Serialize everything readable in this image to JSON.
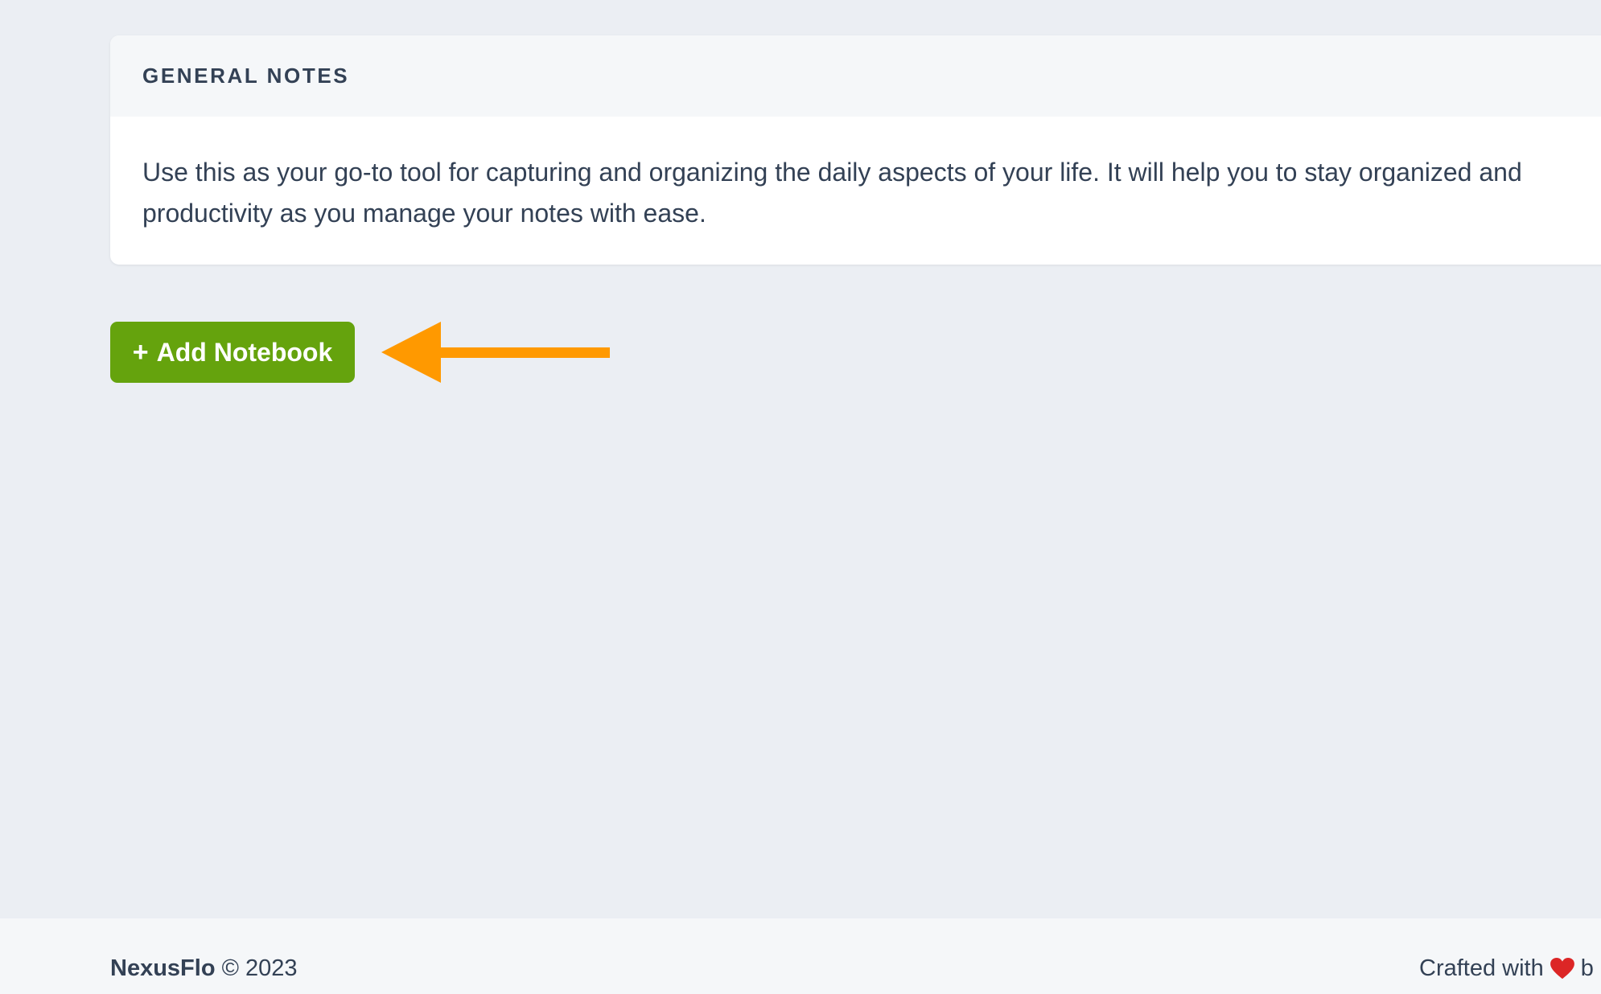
{
  "card": {
    "title": "GENERAL NOTES",
    "description": "Use this as your go-to tool for capturing and organizing the daily aspects of your life. It will help you to stay organized and productivity as you manage your notes with ease."
  },
  "actions": {
    "add_notebook_plus": "+",
    "add_notebook_label": "Add Notebook"
  },
  "footer": {
    "brand": "NexusFlo",
    "copyright": "© 2023",
    "crafted_prefix": "Crafted with",
    "crafted_suffix": "b"
  },
  "colors": {
    "background": "#ebeef3",
    "card_header": "#f5f7f9",
    "primary_button": "#65a30d",
    "annotation_arrow": "#ff9900",
    "heart": "#dc2626",
    "text": "#334155"
  },
  "icons": {
    "annotation": "arrow-left-icon",
    "footer": "heart-icon"
  }
}
